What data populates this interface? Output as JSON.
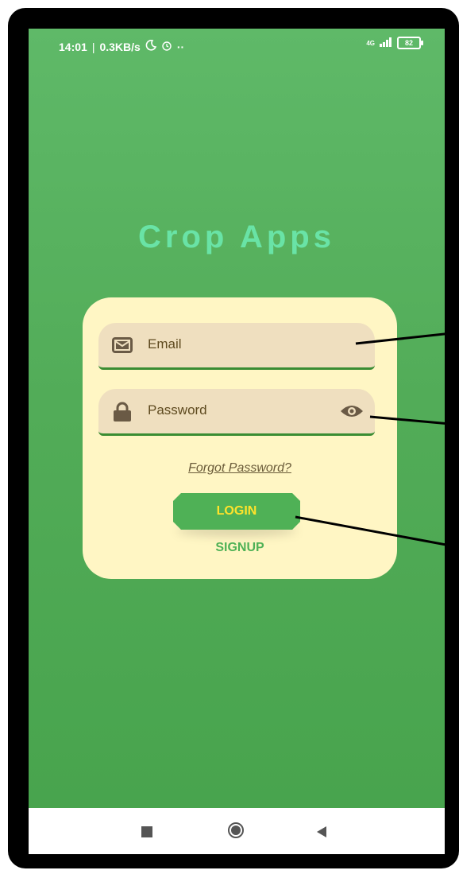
{
  "status_bar": {
    "time": "14:01",
    "speed": "0.3KB/s",
    "extra": "··",
    "network": "4G",
    "battery": "82"
  },
  "app": {
    "title": "Crop Apps"
  },
  "login_form": {
    "email_placeholder": "Email",
    "password_placeholder": "Password",
    "forgot_password": "Forgot Password?",
    "login_label": "LOGIN",
    "signup_label": "SIGNUP"
  },
  "colors": {
    "background": "#52ac58",
    "card": "#fff6c4",
    "field": "#efdfbf",
    "title": "#69e3a6",
    "login_button": "#4fb156",
    "login_text": "#ffe32b"
  },
  "icons": [
    "mail-icon",
    "lock-icon",
    "eye-icon",
    "moon-icon",
    "alarm-icon",
    "signal-icon",
    "battery-icon",
    "nav-recents-icon",
    "nav-home-icon",
    "nav-back-icon"
  ]
}
